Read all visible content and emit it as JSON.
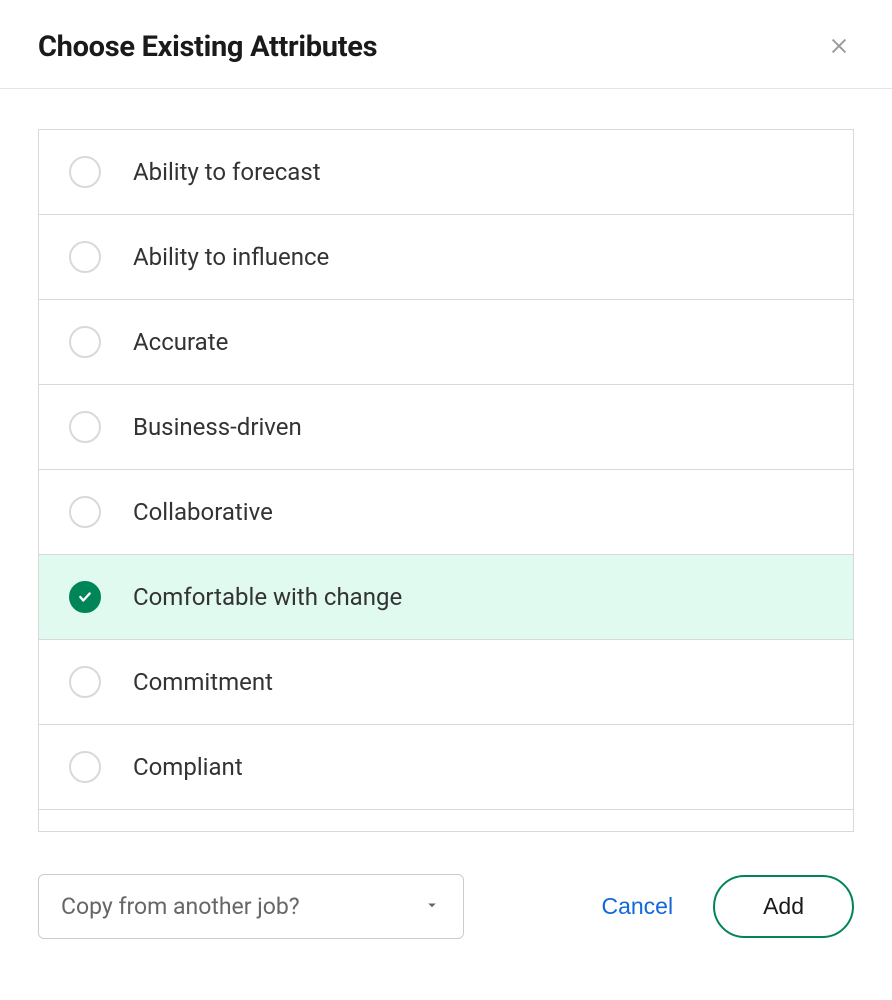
{
  "header": {
    "title": "Choose Existing Attributes"
  },
  "attributes": [
    {
      "label": "Ability to forecast",
      "selected": false
    },
    {
      "label": "Ability to influence",
      "selected": false
    },
    {
      "label": "Accurate",
      "selected": false
    },
    {
      "label": "Business-driven",
      "selected": false
    },
    {
      "label": "Collaborative",
      "selected": false
    },
    {
      "label": "Comfortable with change",
      "selected": true
    },
    {
      "label": "Commitment",
      "selected": false
    },
    {
      "label": "Compliant",
      "selected": false
    }
  ],
  "footer": {
    "dropdown_label": "Copy from another job?",
    "cancel_label": "Cancel",
    "add_label": "Add"
  }
}
